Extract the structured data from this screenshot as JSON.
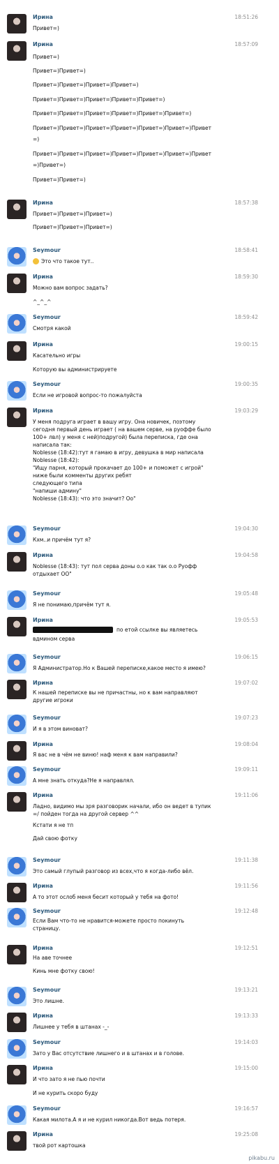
{
  "messages": [
    {
      "author": "Ирина",
      "time": "18:51:26",
      "lines": [
        "Привет=)"
      ]
    },
    {
      "author": "Ирина",
      "time": "18:57:09",
      "lines": [
        "Привет=)",
        "Привет=)Привет=)",
        "Привет=)Привет=)Привет=)Привет=)",
        "Привет=)Привет=)Привет=)Привет=)Привет=)",
        "Привет=)Привет=)Привет=)Привет=)Привет=)Привет=)",
        "Привет=)Привет=)Привет=)Привет=)Привет=)Привет=)Привет",
        "=)",
        "Привет=)Привет=)Привет=)Привет=)Привет=)Привет=)Привет",
        "=)Привет=)",
        "Привет=)Привет=)"
      ]
    },
    {
      "author": "Ирина",
      "time": "18:57:38",
      "lines": [
        "Привет=)Привет=)Привет=)",
        "Привет=)Привет=)Привет=)"
      ]
    },
    {
      "author": "Seymour",
      "time": "18:58:41",
      "lines": [
        "Это что такое тут.."
      ]
    },
    {
      "author": "Ирина",
      "time": "18:59:30",
      "lines": [
        "Можно вам вопрос задать?",
        "^_^_^"
      ]
    },
    {
      "author": "Seymour",
      "time": "18:59:42",
      "lines": [
        "Смотря какой"
      ]
    },
    {
      "author": "Ирина",
      "time": "19:00:15",
      "lines": [
        "Касательно игры",
        "Которую вы администрируете"
      ]
    },
    {
      "author": "Seymour",
      "time": "19:00:35",
      "lines": [
        "Если не игровой вопрос-то пожалуйста"
      ]
    },
    {
      "author": "Ирина",
      "time": "19:03:29",
      "lines": [
        "У меня подруга играет в вашу игру. Она новичек, поэтому",
        "сегодня первый день играет ( на вашем серве, на руоффе было",
        "100+ лвл) у меня с ней)подругой) была переписка, где она",
        "написала так:",
        "Noblesse (18:42):тут я гамаю в игру, девушка в мир написала",
        "Noblesse (18:42):",
        "\"Ищу парня, который прокачает до 100+ и поможет с игрой\"",
        "ниже были комменты других ребят",
        "следующего типа",
        "\"напиши админу\"",
        "Noblesse (18:43): что это значит? Оо\""
      ]
    },
    {
      "author": "Seymour",
      "time": "19:04:30",
      "lines": [
        "Кхм..и причём тут я?"
      ]
    },
    {
      "author": "Ирина",
      "time": "19:04:58",
      "lines": [
        "Noblesse (18:43): тут пол серва доны о.о как так о.о Руофф",
        "отдыхает ОО\""
      ]
    },
    {
      "author": "Seymour",
      "time": "19:05:48",
      "lines": [
        "Я не понимаю,причём тут я."
      ]
    },
    {
      "author": "Ирина",
      "time": "19:05:53",
      "lines": [
        "по етой ссылке вы являетесь",
        "вдмином серва"
      ]
    },
    {
      "author": "Seymour",
      "time": "19:06:15",
      "lines": [
        "Я Администратор.Но к Вашей переписке,какое место я имею?"
      ]
    },
    {
      "author": "Ирина",
      "time": "19:07:02",
      "lines": [
        "К нашей переписке вы не причастны, но к вам направляют",
        "другие игроки"
      ]
    },
    {
      "author": "Seymour",
      "time": "19:07:23",
      "lines": [
        "И я в этом виноват?"
      ]
    },
    {
      "author": "Ирина",
      "time": "19:08:04",
      "lines": [
        "Я вас не в чём не виню! наф меня к вам направили?"
      ]
    },
    {
      "author": "Seymour",
      "time": "19:09:11",
      "lines": [
        "А мне знать откуда?Не я направлял."
      ]
    },
    {
      "author": "Ирина",
      "time": "19:11:06",
      "lines": [
        "Ладно, видимо мы зря разговорик начали, ибо он ведет в тупик",
        "=/ пойден тогда на другой сервер ^^",
        "Кстати я не тп",
        "Дай свою фотку"
      ]
    },
    {
      "author": "Seymour",
      "time": "19:11:38",
      "lines": [
        "Это самый глупый разговор из всех,что я когда-либо вёл."
      ]
    },
    {
      "author": "Ирина",
      "time": "19:11:56",
      "lines": [
        "А то этот ослоб меня бесит который у тебя на фото!"
      ]
    },
    {
      "author": "Seymour",
      "time": "19:12:48",
      "lines": [
        "Если Вам что-то не нравится-можете просто покинуть",
        "страницу."
      ]
    },
    {
      "author": "Ирина",
      "time": "19:12:51",
      "lines": [
        "На аве точнее",
        "Кинь мне фотку свою!"
      ]
    },
    {
      "author": "Seymour",
      "time": "19:13:21",
      "lines": [
        "Это лишне."
      ]
    },
    {
      "author": "Ирина",
      "time": "19:13:33",
      "lines": [
        "Лишнее у тебя в штанах -_-"
      ]
    },
    {
      "author": "Seymour",
      "time": "19:14:03",
      "lines": [
        "Зато у Вас отсутствие лишнего и в штанах и в голове."
      ]
    },
    {
      "author": "Ирина",
      "time": "19:15:00",
      "lines": [
        "И что зато я не пью почти",
        "И не курить скоро буду"
      ]
    },
    {
      "author": "Seymour",
      "time": "19:16:57",
      "lines": [
        "Какая милота.А я и не курил никогда.Вот ведь потеря."
      ]
    },
    {
      "author": "Ирина",
      "time": "19:25:08",
      "lines": [
        "твой рот картошка"
      ]
    }
  ],
  "watermark": "pikabu.ru"
}
